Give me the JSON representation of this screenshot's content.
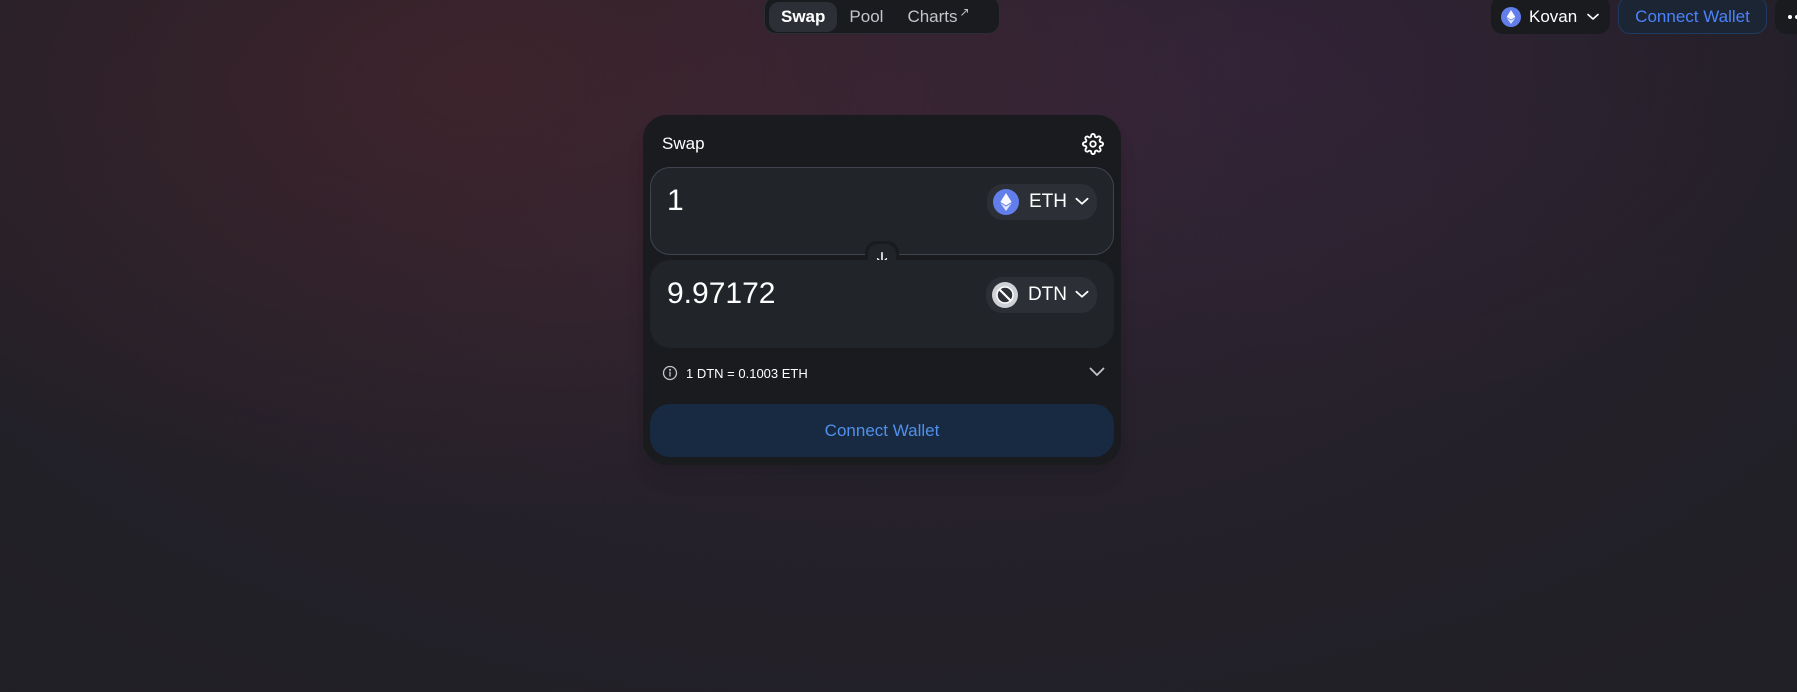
{
  "nav": {
    "tabs": [
      {
        "label": "Swap",
        "active": true
      },
      {
        "label": "Pool",
        "active": false
      },
      {
        "label": "Charts",
        "active": false,
        "external_indicator": "↗"
      }
    ]
  },
  "header": {
    "network": {
      "label": "Kovan",
      "icon": "ethereum-icon"
    },
    "connect_wallet_label": "Connect Wallet",
    "more_icon": "more-icon"
  },
  "swap": {
    "title": "Swap",
    "settings_icon": "gear-icon",
    "input": {
      "amount": "1",
      "token": "ETH",
      "token_icon": "ethereum-icon"
    },
    "output": {
      "amount": "9.97172",
      "token": "DTN",
      "token_icon": "dtn-token-icon"
    },
    "price": "1 DTN = 0.1003 ETH",
    "connect_button_label": "Connect Wallet"
  },
  "colors": {
    "accent": "#4c82fb",
    "card_bg": "#191b1f",
    "field_bg": "#212429",
    "eth": "#627eea"
  }
}
